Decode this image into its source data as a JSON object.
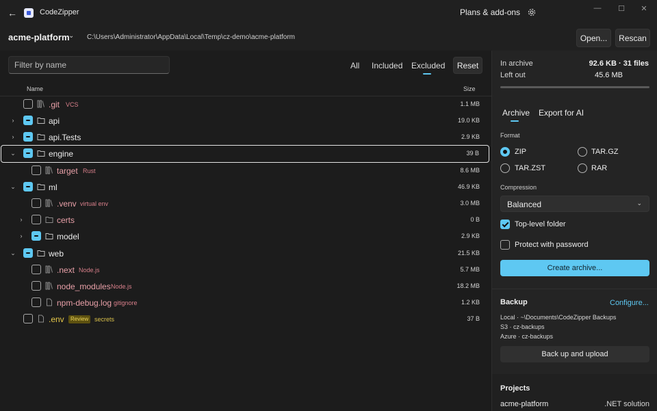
{
  "titlebar": {
    "app_name": "CodeZipper",
    "plans_label": "Plans & add-ons",
    "minimize": "—",
    "maximize": "☐",
    "close": "✕"
  },
  "header": {
    "project_name": "acme-platform",
    "project_path": "C:\\Users\\Administrator\\AppData\\Local\\Temp\\cz-demo\\acme-platform",
    "open_label": "Open...",
    "rescan_label": "Rescan"
  },
  "filter": {
    "placeholder": "Filter by name",
    "tabs": [
      "All",
      "Included",
      "Excluded"
    ],
    "active_tab": "Excluded",
    "reset_label": "Reset"
  },
  "table": {
    "col_name": "Name",
    "col_size": "Size",
    "rows": [
      {
        "name": ".git",
        "tag": "VCS",
        "size": "1.1 MB"
      },
      {
        "name": "api",
        "size": "19.0 KB"
      },
      {
        "name": "api.Tests",
        "size": "2.9 KB"
      },
      {
        "name": "engine",
        "size": "39 B"
      },
      {
        "name": "target",
        "tag": "Rust",
        "size": "8.6 MB"
      },
      {
        "name": "ml",
        "size": "46.9 KB"
      },
      {
        "name": ".venv",
        "tag": "virtual env",
        "size": "3.0 MB"
      },
      {
        "name": "certs",
        "size": "0 B"
      },
      {
        "name": "model",
        "size": "2.9 KB"
      },
      {
        "name": "web",
        "size": "21.5 KB"
      },
      {
        "name": ".next",
        "tag": "Node.js",
        "size": "5.7 MB"
      },
      {
        "name": "node_modules",
        "tag": "Node.js",
        "size": "18.2 MB"
      },
      {
        "name": "npm-debug.log",
        "tag": "gitignore",
        "size": "1.2 KB"
      },
      {
        "name": ".env",
        "badge": "Review",
        "tag": "secrets",
        "size": "37 B"
      }
    ]
  },
  "summary": {
    "in_archive_label": "In archive",
    "in_archive_value": "92.6 KB · 31 files",
    "left_out_label": "Left out",
    "left_out_value": "45.6 MB"
  },
  "right_tabs": [
    "Archive",
    "Export for AI"
  ],
  "format": {
    "label": "Format",
    "options": [
      "ZIP",
      "TAR.GZ",
      "TAR.ZST",
      "RAR"
    ],
    "selected": "ZIP"
  },
  "compression": {
    "label": "Compression",
    "value": "Balanced"
  },
  "options": {
    "top_level_folder": "Top-level folder",
    "protect_password": "Protect with password"
  },
  "create_archive_label": "Create archive...",
  "backup": {
    "title": "Backup",
    "configure_label": "Configure...",
    "targets": [
      "Local · ~\\Documents\\CodeZipper Backups",
      "S3 · cz-backups",
      "Azure · cz-backups"
    ],
    "upload_label": "Back up and upload"
  },
  "projects": {
    "title": "Projects",
    "items": [
      {
        "name": "acme-platform",
        "type": ".NET solution"
      }
    ]
  },
  "colors": {
    "accent": "#5ec8f2",
    "excluded": "#e8a0a8",
    "review": "#e6c84a"
  }
}
